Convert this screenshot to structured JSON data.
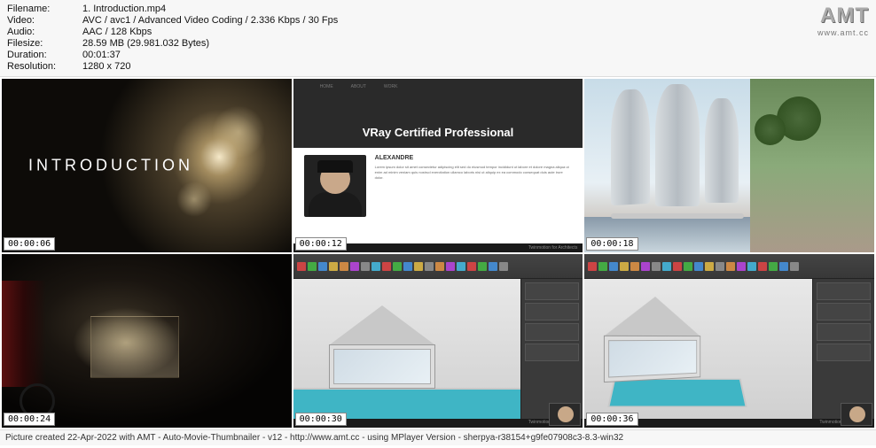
{
  "meta": {
    "filename_label": "Filename:",
    "filename": "1. Introduction.mp4",
    "video_label": "Video:",
    "video": "AVC / avc1 / Advanced Video Coding / 2.336 Kbps / 30 Fps",
    "audio_label": "Audio:",
    "audio": "AAC / 128 Kbps",
    "filesize_label": "Filesize:",
    "filesize": "28.59 MB (29.981.032 Bytes)",
    "duration_label": "Duration:",
    "duration": "00:01:37",
    "resolution_label": "Resolution:",
    "resolution": "1280 x 720"
  },
  "logo": {
    "main": "AMT",
    "sub": "www.amt.cc"
  },
  "thumbs": [
    {
      "ts": "00:00:06",
      "text": "INTRODUCTION"
    },
    {
      "ts": "00:00:12",
      "title": "VRay Certified Professional",
      "name": "ALEXANDRE ",
      "foot": "Twinmotion for Architects"
    },
    {
      "ts": "00:00:18"
    },
    {
      "ts": "00:00:24"
    },
    {
      "ts": "00:00:30",
      "foot": "Twinmotion for Architects"
    },
    {
      "ts": "00:00:36",
      "foot": "Twinmotion for Architects"
    }
  ],
  "footer": "Picture created 22-Apr-2022 with AMT - Auto-Movie-Thumbnailer - v12 - http://www.amt.cc - using MPlayer Version - sherpya-r38154+g9fe07908c3-8.3-win32"
}
